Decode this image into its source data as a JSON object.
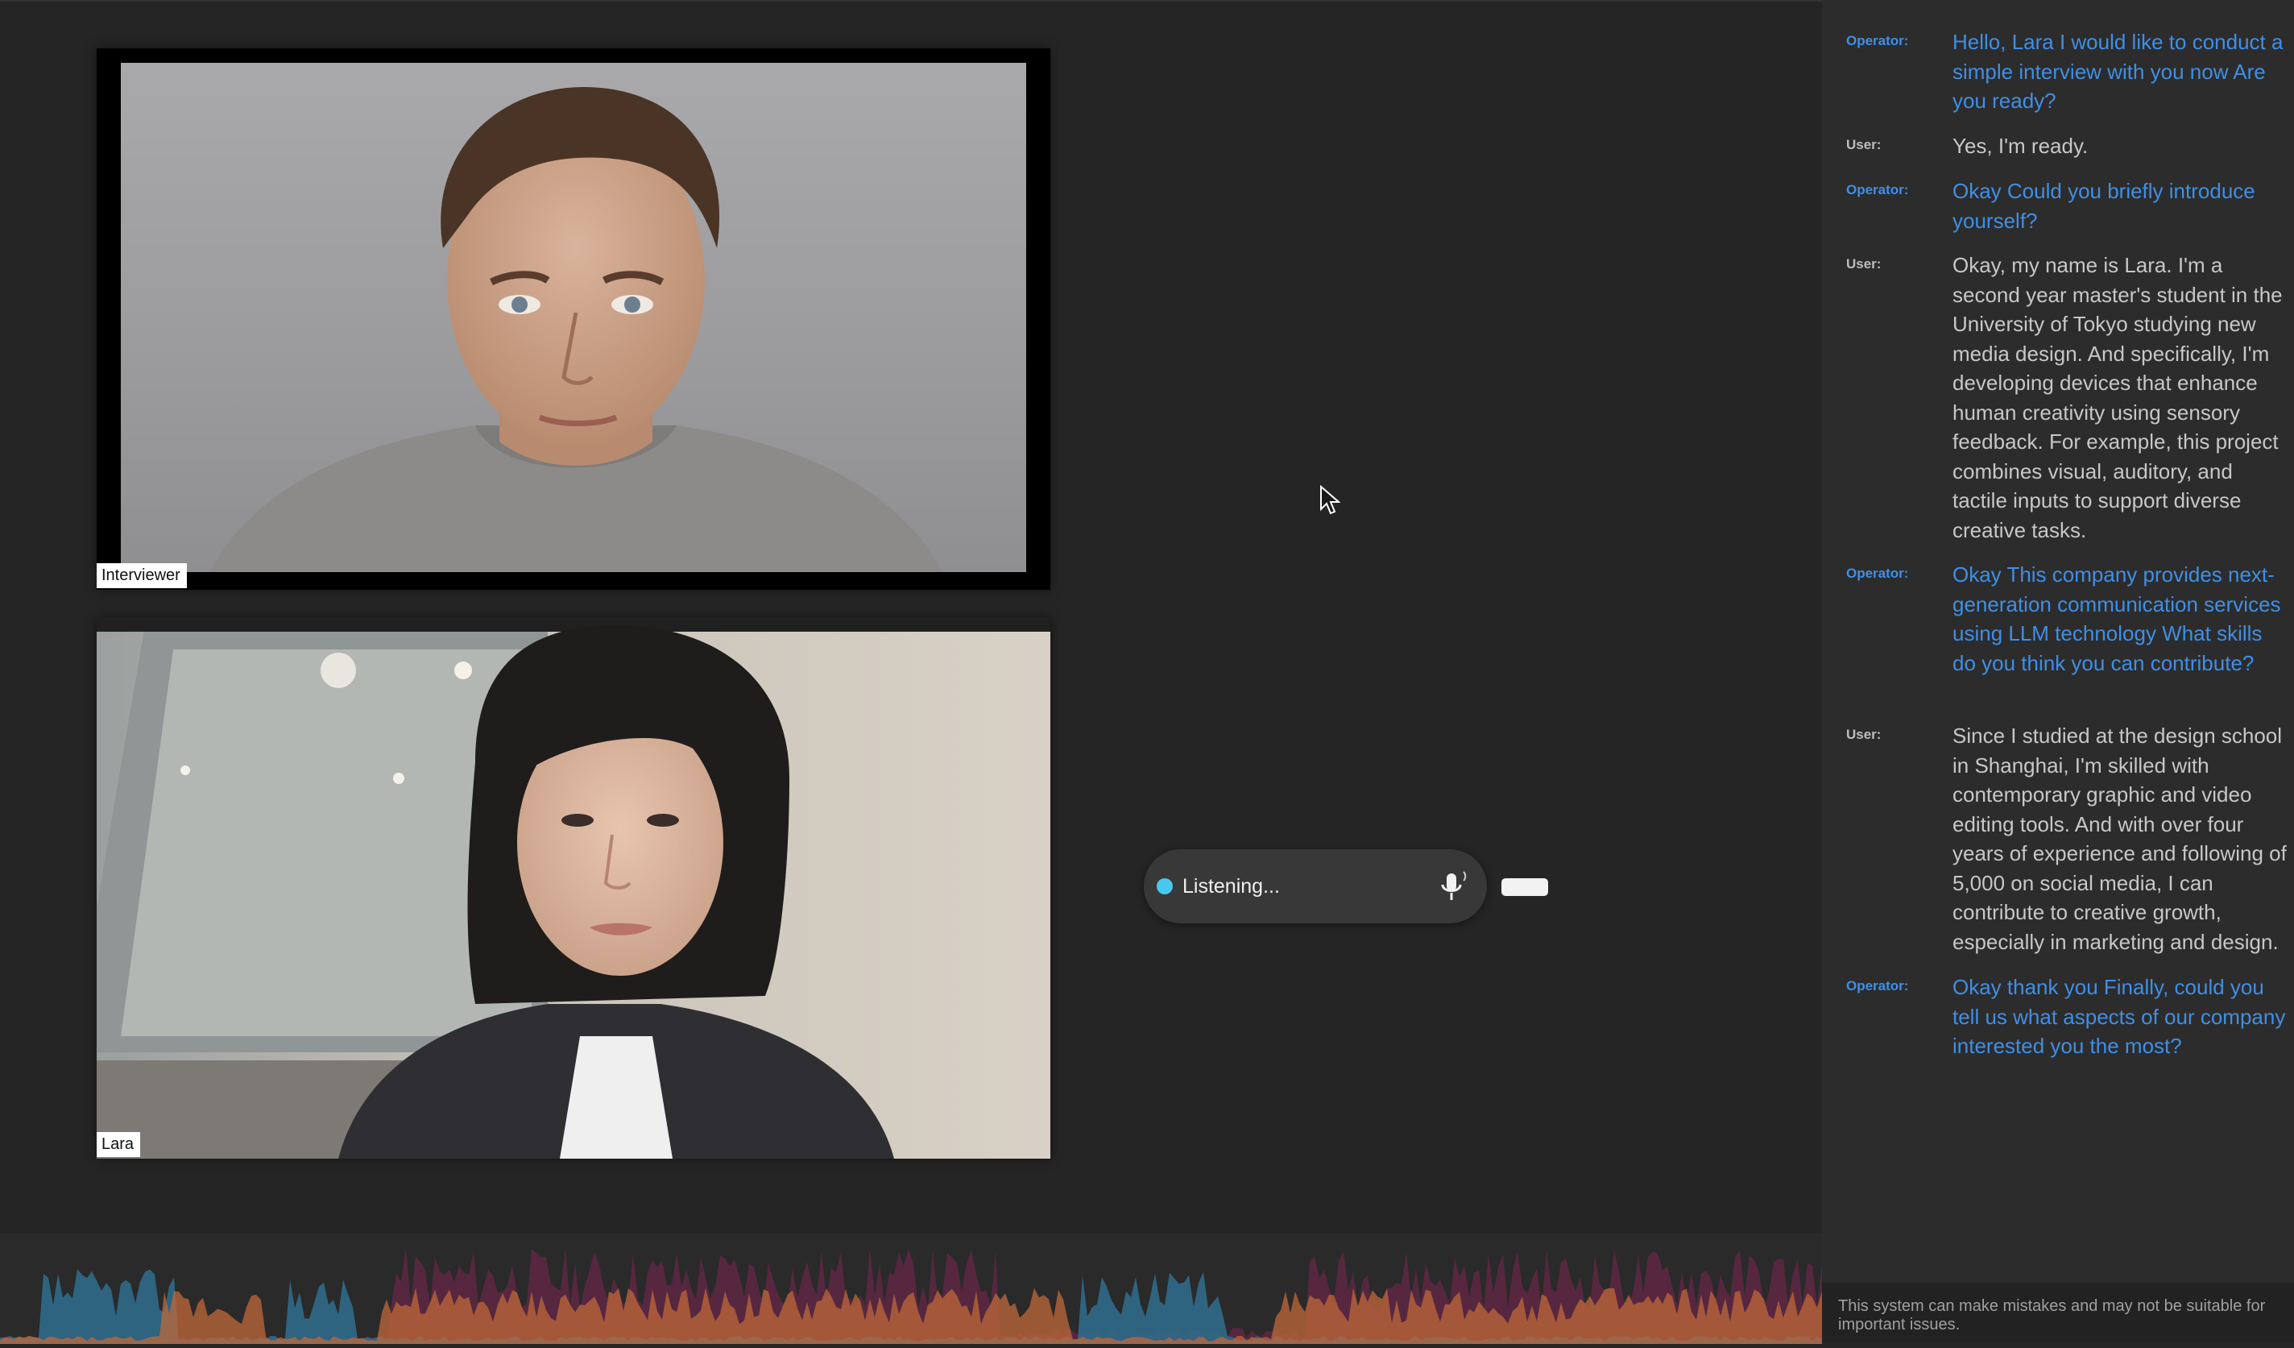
{
  "tiles": {
    "interviewer_label": "Interviewer",
    "user_label": "Lara"
  },
  "status": {
    "listening_label": "Listening..."
  },
  "colors": {
    "operator_text": "#3f8fe6",
    "user_text": "#c7c7c7",
    "listening_dot": "#49c7ee",
    "background": "#252525"
  },
  "transcript": {
    "messages": [
      {
        "role": "Operator:",
        "text": "Hello, Lara I would like to conduct a simple interview with you now Are you ready?"
      },
      {
        "role": "User:",
        "text": "Yes, I'm ready."
      },
      {
        "role": "Operator:",
        "text": "Okay Could you briefly introduce yourself?"
      },
      {
        "role": "User:",
        "text": "Okay, my name is Lara. I'm a second year master's student in the University of Tokyo studying new media design. And specifically, I'm developing devices that enhance human creativity using sensory feedback. For example, this project combines visual, auditory, and tactile inputs to support diverse creative tasks."
      },
      {
        "role": "Operator:",
        "text": "Okay This company provides next-generation communication services using LLM technology What skills do you think you can contribute?"
      },
      {
        "role": "User:",
        "text": "Since I studied at the design school in Shanghai, I'm skilled with contemporary graphic and video editing tools. And with over four years of experience and following of 5,000 on social media, I can contribute to creative growth, especially in marketing and design."
      },
      {
        "role": "Operator:",
        "text": "Okay thank you Finally, could you tell us what aspects of our company interested you the most?"
      }
    ]
  },
  "footer": {
    "disclaimer": "This system can make mistakes and may not be suitable for important issues."
  },
  "icons": {
    "mic": "microphone-icon",
    "cursor": "mouse-pointer-icon"
  }
}
